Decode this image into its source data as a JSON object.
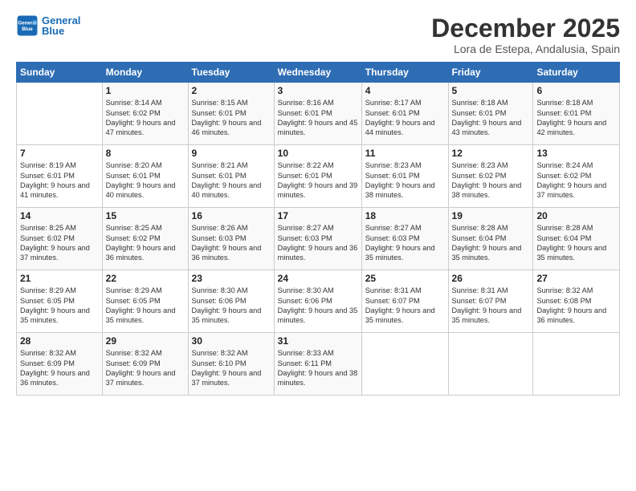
{
  "logo": {
    "line1": "General",
    "line2": "Blue"
  },
  "title": "December 2025",
  "location": "Lora de Estepa, Andalusia, Spain",
  "weekdays": [
    "Sunday",
    "Monday",
    "Tuesday",
    "Wednesday",
    "Thursday",
    "Friday",
    "Saturday"
  ],
  "weeks": [
    [
      {
        "day": "",
        "sunrise": "",
        "sunset": "",
        "daylight": ""
      },
      {
        "day": "1",
        "sunrise": "Sunrise: 8:14 AM",
        "sunset": "Sunset: 6:02 PM",
        "daylight": "Daylight: 9 hours and 47 minutes."
      },
      {
        "day": "2",
        "sunrise": "Sunrise: 8:15 AM",
        "sunset": "Sunset: 6:01 PM",
        "daylight": "Daylight: 9 hours and 46 minutes."
      },
      {
        "day": "3",
        "sunrise": "Sunrise: 8:16 AM",
        "sunset": "Sunset: 6:01 PM",
        "daylight": "Daylight: 9 hours and 45 minutes."
      },
      {
        "day": "4",
        "sunrise": "Sunrise: 8:17 AM",
        "sunset": "Sunset: 6:01 PM",
        "daylight": "Daylight: 9 hours and 44 minutes."
      },
      {
        "day": "5",
        "sunrise": "Sunrise: 8:18 AM",
        "sunset": "Sunset: 6:01 PM",
        "daylight": "Daylight: 9 hours and 43 minutes."
      },
      {
        "day": "6",
        "sunrise": "Sunrise: 8:18 AM",
        "sunset": "Sunset: 6:01 PM",
        "daylight": "Daylight: 9 hours and 42 minutes."
      }
    ],
    [
      {
        "day": "7",
        "sunrise": "Sunrise: 8:19 AM",
        "sunset": "Sunset: 6:01 PM",
        "daylight": "Daylight: 9 hours and 41 minutes."
      },
      {
        "day": "8",
        "sunrise": "Sunrise: 8:20 AM",
        "sunset": "Sunset: 6:01 PM",
        "daylight": "Daylight: 9 hours and 40 minutes."
      },
      {
        "day": "9",
        "sunrise": "Sunrise: 8:21 AM",
        "sunset": "Sunset: 6:01 PM",
        "daylight": "Daylight: 9 hours and 40 minutes."
      },
      {
        "day": "10",
        "sunrise": "Sunrise: 8:22 AM",
        "sunset": "Sunset: 6:01 PM",
        "daylight": "Daylight: 9 hours and 39 minutes."
      },
      {
        "day": "11",
        "sunrise": "Sunrise: 8:23 AM",
        "sunset": "Sunset: 6:01 PM",
        "daylight": "Daylight: 9 hours and 38 minutes."
      },
      {
        "day": "12",
        "sunrise": "Sunrise: 8:23 AM",
        "sunset": "Sunset: 6:02 PM",
        "daylight": "Daylight: 9 hours and 38 minutes."
      },
      {
        "day": "13",
        "sunrise": "Sunrise: 8:24 AM",
        "sunset": "Sunset: 6:02 PM",
        "daylight": "Daylight: 9 hours and 37 minutes."
      }
    ],
    [
      {
        "day": "14",
        "sunrise": "Sunrise: 8:25 AM",
        "sunset": "Sunset: 6:02 PM",
        "daylight": "Daylight: 9 hours and 37 minutes."
      },
      {
        "day": "15",
        "sunrise": "Sunrise: 8:25 AM",
        "sunset": "Sunset: 6:02 PM",
        "daylight": "Daylight: 9 hours and 36 minutes."
      },
      {
        "day": "16",
        "sunrise": "Sunrise: 8:26 AM",
        "sunset": "Sunset: 6:03 PM",
        "daylight": "Daylight: 9 hours and 36 minutes."
      },
      {
        "day": "17",
        "sunrise": "Sunrise: 8:27 AM",
        "sunset": "Sunset: 6:03 PM",
        "daylight": "Daylight: 9 hours and 36 minutes."
      },
      {
        "day": "18",
        "sunrise": "Sunrise: 8:27 AM",
        "sunset": "Sunset: 6:03 PM",
        "daylight": "Daylight: 9 hours and 35 minutes."
      },
      {
        "day": "19",
        "sunrise": "Sunrise: 8:28 AM",
        "sunset": "Sunset: 6:04 PM",
        "daylight": "Daylight: 9 hours and 35 minutes."
      },
      {
        "day": "20",
        "sunrise": "Sunrise: 8:28 AM",
        "sunset": "Sunset: 6:04 PM",
        "daylight": "Daylight: 9 hours and 35 minutes."
      }
    ],
    [
      {
        "day": "21",
        "sunrise": "Sunrise: 8:29 AM",
        "sunset": "Sunset: 6:05 PM",
        "daylight": "Daylight: 9 hours and 35 minutes."
      },
      {
        "day": "22",
        "sunrise": "Sunrise: 8:29 AM",
        "sunset": "Sunset: 6:05 PM",
        "daylight": "Daylight: 9 hours and 35 minutes."
      },
      {
        "day": "23",
        "sunrise": "Sunrise: 8:30 AM",
        "sunset": "Sunset: 6:06 PM",
        "daylight": "Daylight: 9 hours and 35 minutes."
      },
      {
        "day": "24",
        "sunrise": "Sunrise: 8:30 AM",
        "sunset": "Sunset: 6:06 PM",
        "daylight": "Daylight: 9 hours and 35 minutes."
      },
      {
        "day": "25",
        "sunrise": "Sunrise: 8:31 AM",
        "sunset": "Sunset: 6:07 PM",
        "daylight": "Daylight: 9 hours and 35 minutes."
      },
      {
        "day": "26",
        "sunrise": "Sunrise: 8:31 AM",
        "sunset": "Sunset: 6:07 PM",
        "daylight": "Daylight: 9 hours and 35 minutes."
      },
      {
        "day": "27",
        "sunrise": "Sunrise: 8:32 AM",
        "sunset": "Sunset: 6:08 PM",
        "daylight": "Daylight: 9 hours and 36 minutes."
      }
    ],
    [
      {
        "day": "28",
        "sunrise": "Sunrise: 8:32 AM",
        "sunset": "Sunset: 6:09 PM",
        "daylight": "Daylight: 9 hours and 36 minutes."
      },
      {
        "day": "29",
        "sunrise": "Sunrise: 8:32 AM",
        "sunset": "Sunset: 6:09 PM",
        "daylight": "Daylight: 9 hours and 37 minutes."
      },
      {
        "day": "30",
        "sunrise": "Sunrise: 8:32 AM",
        "sunset": "Sunset: 6:10 PM",
        "daylight": "Daylight: 9 hours and 37 minutes."
      },
      {
        "day": "31",
        "sunrise": "Sunrise: 8:33 AM",
        "sunset": "Sunset: 6:11 PM",
        "daylight": "Daylight: 9 hours and 38 minutes."
      },
      {
        "day": "",
        "sunrise": "",
        "sunset": "",
        "daylight": ""
      },
      {
        "day": "",
        "sunrise": "",
        "sunset": "",
        "daylight": ""
      },
      {
        "day": "",
        "sunrise": "",
        "sunset": "",
        "daylight": ""
      }
    ]
  ]
}
